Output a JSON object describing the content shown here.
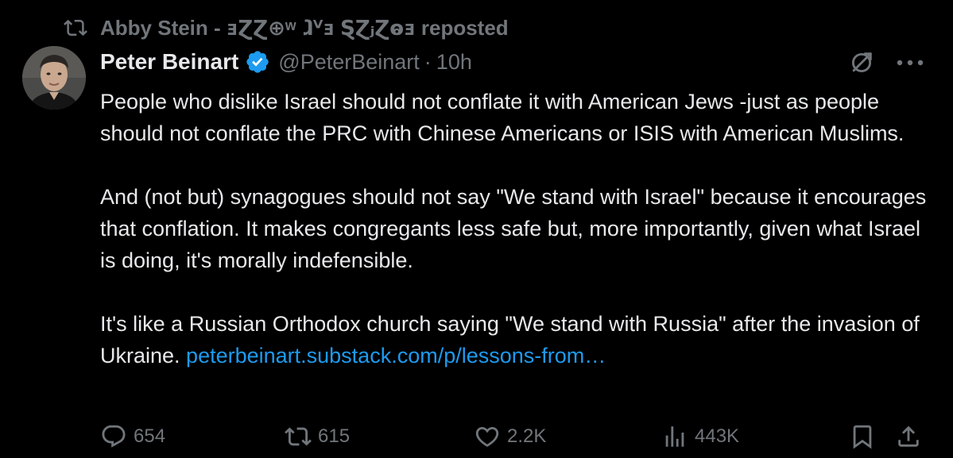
{
  "repost_banner": {
    "icon": "repost-icon",
    "text": "Abby Stein - ⱻⱿⱿ⊕ʷ ⱹⱽⱻ ⱾⱿⱼⱿⱺⱻ reposted"
  },
  "tweet": {
    "author_name": "Peter Beinart",
    "verified_icon": "verified-badge-icon",
    "handle": "@PeterBeinart",
    "separator": "·",
    "time": "10h",
    "paragraphs": [
      "People who dislike Israel should not conflate it with American Jews -just as people should not conflate the PRC with Chinese Americans or ISIS with American Muslims.",
      "And (not but) synagogues should not say \"We stand with Israel\" because it encourages that conflation. It makes congregants less safe but, more importantly, given what Israel is doing, it's morally indefensible."
    ],
    "last_paragraph_text": "It's like a Russian Orthodox church saying \"We stand with Russia\" after the invasion of Ukraine. ",
    "link_text": "peterbeinart.substack.com/p/lessons-from…"
  },
  "actions": {
    "reply_count": "654",
    "repost_count": "615",
    "like_count": "2.2K",
    "view_count": "443K"
  },
  "colors": {
    "background": "#000000",
    "primary_text": "#e7e9ea",
    "secondary_text": "#71767b",
    "link": "#1d9bf0",
    "verified": "#1d9bf0"
  }
}
